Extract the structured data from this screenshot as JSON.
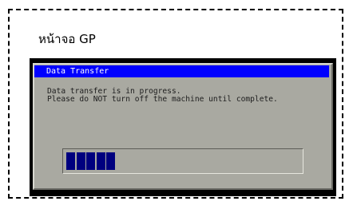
{
  "caption": "หน้าจอ GP",
  "dialog": {
    "title": "Data Transfer",
    "message_line1": "Data transfer is in progress.",
    "message_line2": "Please do NOT turn off the machine until complete."
  },
  "progress": {
    "filled_segments": 5,
    "fraction": 0.2,
    "color": "#00007f"
  },
  "colors": {
    "title_bar": "#0000ff",
    "dialog_bg": "#a9a9a1",
    "screen_bezel": "#000000"
  }
}
